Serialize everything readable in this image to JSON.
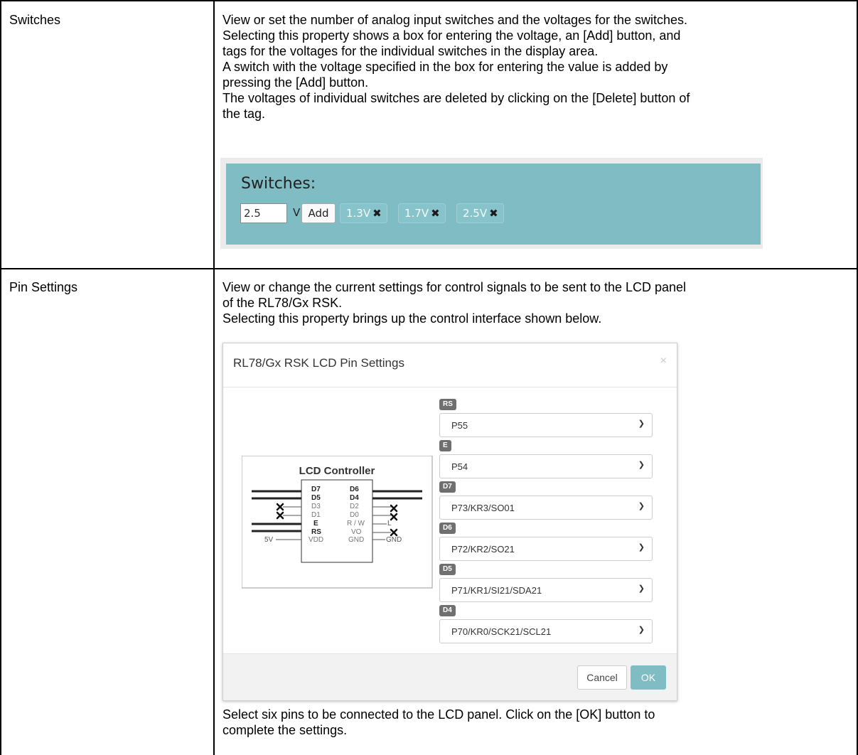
{
  "rows": [
    {
      "label": "Switches",
      "description": [
        "View or set the number of analog input switches and the voltages for the switches.",
        "Selecting this property shows a box for entering the voltage, an [Add] button, and",
        "tags for the voltages for the individual switches in the display area.",
        "A switch with the voltage specified in the box for entering the value is added by",
        "pressing the [Add] button.",
        "The voltages of individual switches are deleted by clicking on the [Delete] button of",
        "the tag."
      ]
    },
    {
      "label": "Pin Settings",
      "description": [
        "View or change the current settings for control signals to be sent to the LCD panel",
        "of the RL78/Gx RSK.",
        "Selecting this property brings up the control interface shown below."
      ],
      "footer": [
        "Select six pins to be connected to the LCD panel. Click on the [OK] button to",
        "complete the settings."
      ]
    }
  ],
  "switches_widget": {
    "title": "Switches:",
    "input_value": "2.5",
    "unit": "V",
    "add_label": "Add",
    "tags": [
      "1.3V",
      "1.7V",
      "2.5V"
    ],
    "delete_glyph": "✖",
    "colors": {
      "panel": "#7fbcc4",
      "tag": "#86c3ca"
    }
  },
  "dialog": {
    "title": "RL78/Gx RSK LCD Pin Settings",
    "close_glyph": "×",
    "cancel_label": "Cancel",
    "ok_label": "OK",
    "pins": [
      {
        "badge": "RS",
        "value": "P55"
      },
      {
        "badge": "E",
        "value": "P54"
      },
      {
        "badge": "D7",
        "value": "P73/KR3/SO01"
      },
      {
        "badge": "D6",
        "value": "P72/KR2/SO21"
      },
      {
        "badge": "D5",
        "value": "P71/KR1/SI21/SDA21"
      },
      {
        "badge": "D4",
        "value": "P70/KR0/SCK21/SCL21"
      }
    ],
    "diagram": {
      "title": "LCD Controller",
      "left_pins": [
        "D7",
        "D5",
        "D3",
        "D1",
        "E",
        "RS",
        "VDD"
      ],
      "right_pins": [
        "D6",
        "D4",
        "D2",
        "D0",
        "R / W",
        "VO",
        "GND"
      ],
      "vdd_label": "5V",
      "rw_label": "L",
      "gnd_label": "GND"
    }
  }
}
